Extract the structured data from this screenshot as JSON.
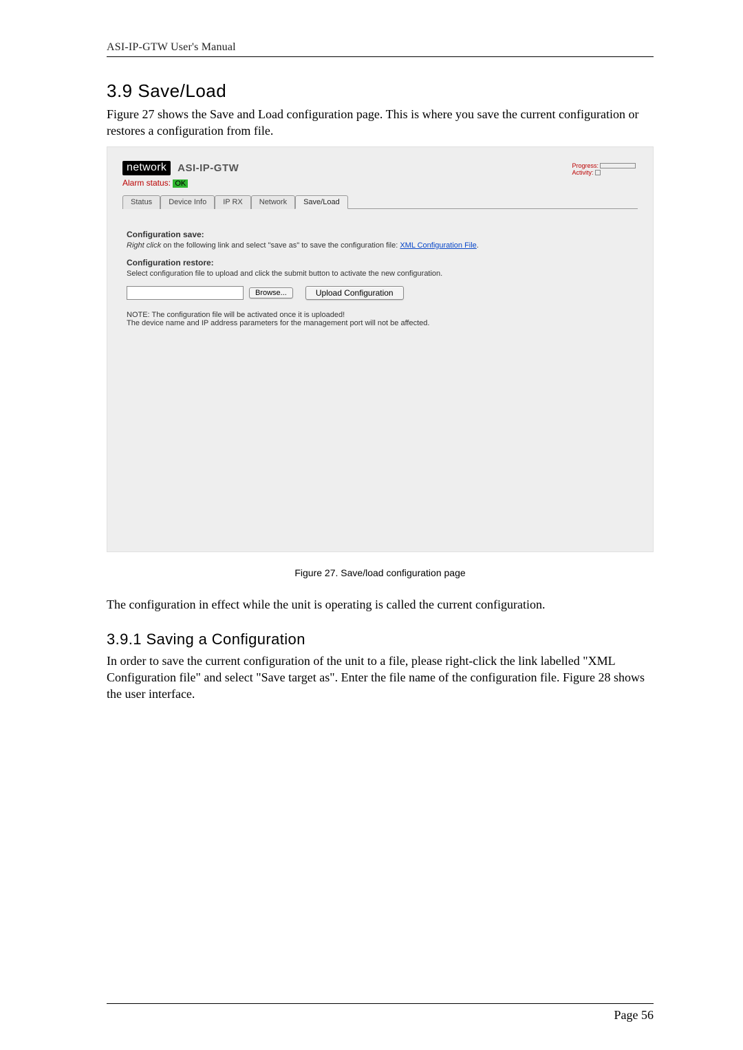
{
  "doc": {
    "running_header": "ASI-IP-GTW User's Manual",
    "page_number": "Page 56"
  },
  "section": {
    "title": "3.9 Save/Load",
    "intro": "Figure 27 shows the Save and Load configuration page. This is where you save the current configuration or restores a configuration from file."
  },
  "screenshot": {
    "logo_text": "network",
    "logo_sub": "ASI-IP-GTW",
    "alarm_label": "Alarm status:",
    "alarm_value": "OK",
    "progress_label": "Progress:",
    "activity_label": "Activity:",
    "tabs": {
      "status": "Status",
      "device_info": "Device Info",
      "ip_rx": "IP RX",
      "network": "Network",
      "save_load": "Save/Load"
    },
    "config_save_h": "Configuration save:",
    "config_save_prefix_em": "Right click",
    "config_save_mid": " on the following link and select \"save as\" to save the configuration file: ",
    "config_save_link": "XML Configuration File",
    "config_save_suffix": ".",
    "config_restore_h": "Configuration restore:",
    "config_restore_p": "Select configuration file to upload and click the submit button to activate the new configuration.",
    "browse_label": "Browse...",
    "upload_label": "Upload Configuration",
    "note_line1": "NOTE: The configuration file will be activated once it is uploaded!",
    "note_line2": "The device name and IP address parameters for the management port will not be affected."
  },
  "figure_caption": "Figure 27. Save/load configuration page",
  "para_after_figure": "The configuration in effect while the unit is operating is called the current configuration.",
  "subsection": {
    "title": "3.9.1 Saving a Configuration",
    "body": "In order to save the current configuration of the unit to a file, please right-click the link labelled \"XML Configuration file\" and select \"Save target as\". Enter the file name of the configuration file. Figure 28 shows the user interface."
  }
}
